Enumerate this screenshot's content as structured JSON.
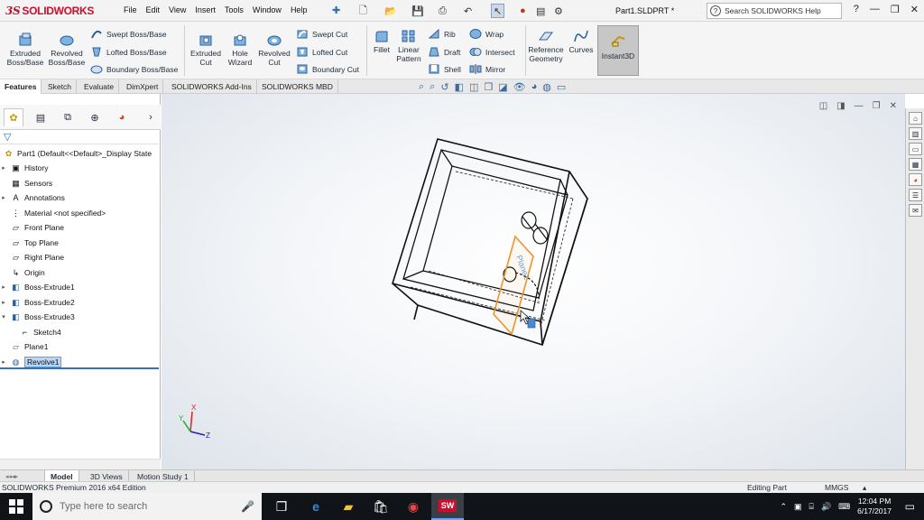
{
  "app": {
    "logo_text": "SOLIDWORKS",
    "document_title": "Part1.SLDPRT *",
    "search_placeholder": "Search SOLIDWORKS Help",
    "menus": [
      "File",
      "Edit",
      "View",
      "Insert",
      "Tools",
      "Window",
      "Help"
    ]
  },
  "ribbon": {
    "extruded_boss": "Extruded Boss/Base",
    "revolved_boss": "Revolved Boss/Base",
    "swept_boss": "Swept Boss/Base",
    "lofted_boss": "Lofted Boss/Base",
    "boundary_boss": "Boundary Boss/Base",
    "extruded_cut": "Extruded Cut",
    "hole_wizard": "Hole Wizard",
    "revolved_cut": "Revolved Cut",
    "swept_cut": "Swept Cut",
    "lofted_cut": "Lofted Cut",
    "boundary_cut": "Boundary Cut",
    "fillet": "Fillet",
    "linear_pattern": "Linear Pattern",
    "rib": "Rib",
    "draft": "Draft",
    "shell": "Shell",
    "wrap": "Wrap",
    "intersect": "Intersect",
    "mirror": "Mirror",
    "reference_geometry": "Reference Geometry",
    "curves": "Curves",
    "instant3d": "Instant3D"
  },
  "command_tabs": [
    "Features",
    "Sketch",
    "Evaluate",
    "DimXpert",
    "SOLIDWORKS Add-Ins",
    "SOLIDWORKS MBD"
  ],
  "tree": {
    "root": "Part1  (Default<<Default>_Display State",
    "items": [
      {
        "label": "History",
        "expandable": true
      },
      {
        "label": "Sensors",
        "expandable": false
      },
      {
        "label": "Annotations",
        "expandable": true
      },
      {
        "label": "Material <not specified>",
        "expandable": false
      },
      {
        "label": "Front Plane",
        "expandable": false
      },
      {
        "label": "Top Plane",
        "expandable": false
      },
      {
        "label": "Right Plane",
        "expandable": false
      },
      {
        "label": "Origin",
        "expandable": false
      },
      {
        "label": "Boss-Extrude1",
        "expandable": true
      },
      {
        "label": "Boss-Extrude2",
        "expandable": true
      },
      {
        "label": "Boss-Extrude3",
        "expandable": true,
        "expanded": true
      },
      {
        "label": "Sketch4",
        "expandable": false,
        "child": true
      },
      {
        "label": "Plane1",
        "expandable": false
      },
      {
        "label": "Revolve1",
        "expandable": true,
        "selected": true
      }
    ]
  },
  "viewport": {
    "plane_label": "Plane1",
    "triad": {
      "x": "X",
      "y": "Y",
      "z": "Z"
    }
  },
  "bottom_tabs": [
    "Model",
    "3D Views",
    "Motion Study 1"
  ],
  "status": {
    "edition": "SOLIDWORKS Premium 2016 x64 Edition",
    "mode": "Editing Part",
    "units": "MMGS"
  },
  "taskbar": {
    "search_placeholder": "Type here to search",
    "time": "12:04 PM",
    "date": "6/17/2017"
  },
  "colors": {
    "brand": "#c8102e",
    "selection": "#bad6f2",
    "plane_highlight": "#f0932b"
  }
}
